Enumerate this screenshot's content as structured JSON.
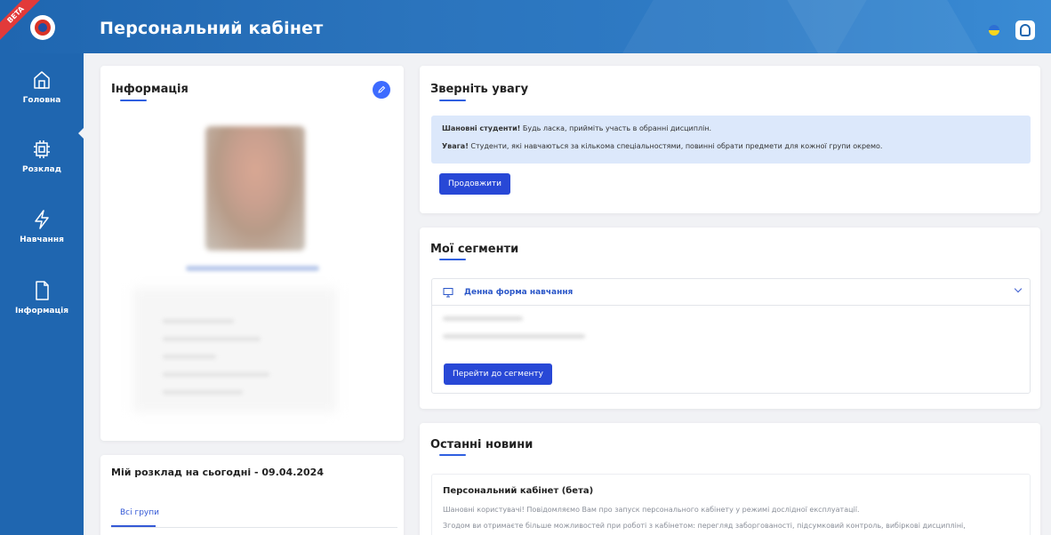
{
  "header": {
    "title": "Персональний кабінет",
    "beta": "BETA"
  },
  "sidebar": {
    "items": [
      {
        "label": "Головна",
        "icon": "home-icon"
      },
      {
        "label": "Розклад",
        "icon": "chip-icon"
      },
      {
        "label": "Навчання",
        "icon": "lightning-icon"
      },
      {
        "label": "Інформація",
        "icon": "document-icon"
      }
    ]
  },
  "info": {
    "title": "Інформація"
  },
  "schedule": {
    "title": "Мій розклад на сьогодні - 09.04.2024",
    "tab": "Всі групи"
  },
  "attention": {
    "title": "Зверніть увагу",
    "line1_bold": "Шановні студенти!",
    "line1_text": " Будь ласка, прийміть участь в обранні дисциплін.",
    "line2_bold": "Увага!",
    "line2_text": " Студенти, які навчаються за кількома спеціальностями, повинні обрати предмети для кожної групи окремо.",
    "button": "Продовжити"
  },
  "segments": {
    "title": "Мої сегменти",
    "item_title": "Денна форма навчання",
    "button": "Перейти до сегменту"
  },
  "news": {
    "title": "Останні новини",
    "item_title": "Персональний кабінет (бета)",
    "line1": "Шановні користувачі! Повідомляємо Вам про запуск персонального кабінету у режимі дослідної експлуатації.",
    "line2": "Згодом ви отримаєте більше можливостей при роботі з кабінетом: перегляд заборгованості, підсумковий контроль, вибіркові дисципліні,"
  },
  "colors": {
    "primary": "#1f66b0",
    "accent": "#2848d6",
    "notice": "#dce8fb"
  }
}
